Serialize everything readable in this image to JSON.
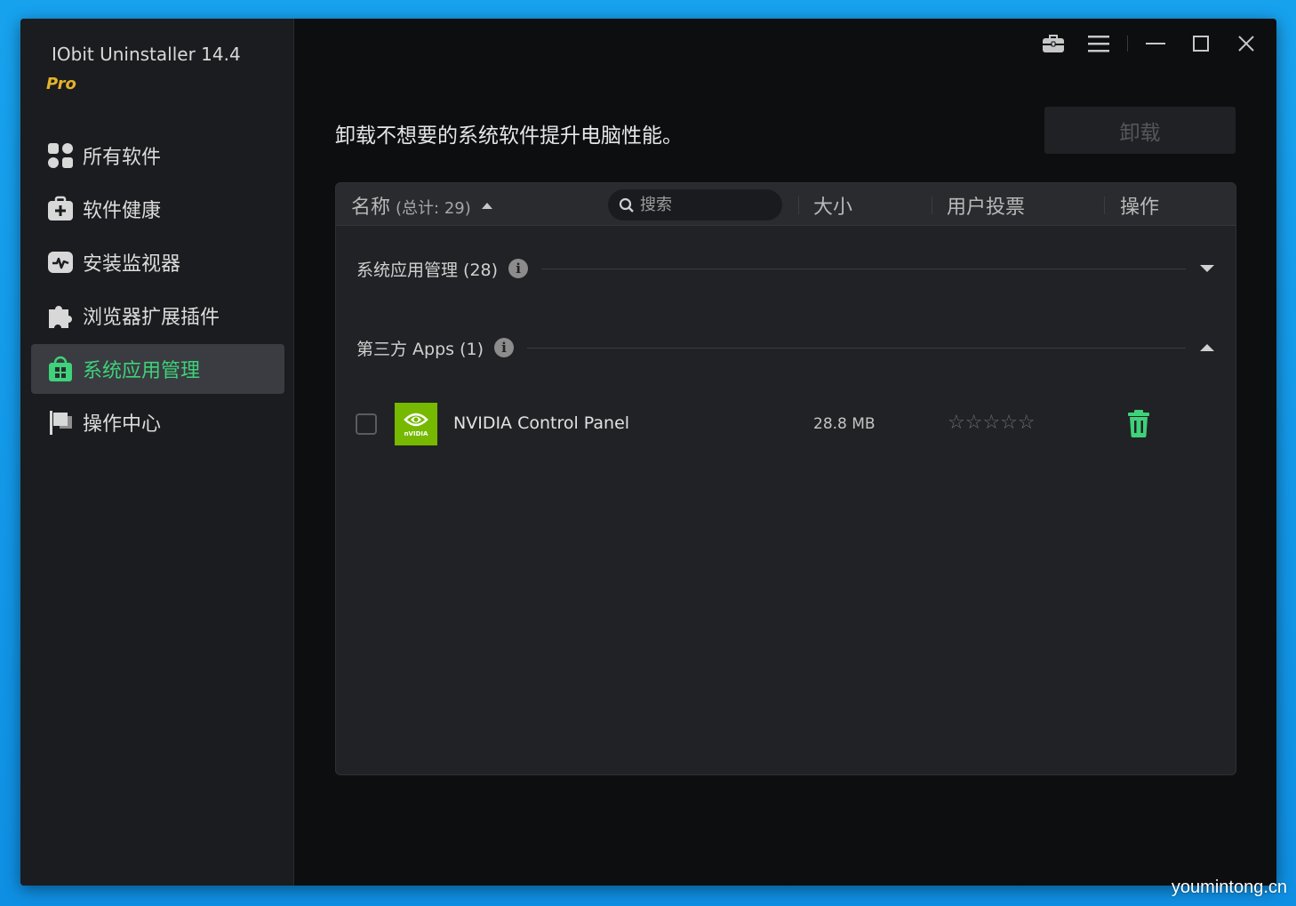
{
  "app": {
    "title": "IObit Uninstaller 14.4",
    "edition": "Pro"
  },
  "sidebar": {
    "items": [
      {
        "label": "所有软件",
        "icon": "grid-apps-icon"
      },
      {
        "label": "软件健康",
        "icon": "first-aid-kit-icon"
      },
      {
        "label": "安装监视器",
        "icon": "monitor-pulse-icon"
      },
      {
        "label": "浏览器扩展插件",
        "icon": "puzzle-icon"
      },
      {
        "label": "系统应用管理",
        "icon": "windows-store-icon",
        "active": true
      },
      {
        "label": "操作中心",
        "icon": "flag-icon"
      }
    ]
  },
  "topbar": {
    "icons": [
      "toolbox-icon",
      "menu-icon",
      "minimize-icon",
      "maximize-icon",
      "close-icon"
    ]
  },
  "main": {
    "heading": "卸载不想要的系统软件提升电脑性能。",
    "uninstall_label": "卸载"
  },
  "table": {
    "headers": {
      "name": "名称",
      "total": "(总计: 29)",
      "size": "大小",
      "rating": "用户投票",
      "action": "操作"
    },
    "search_placeholder": "搜索",
    "groups": [
      {
        "label": "系统应用管理 (28)",
        "expanded": false
      },
      {
        "label": "第三方 Apps (1)",
        "expanded": true
      }
    ],
    "rows": [
      {
        "name": "NVIDIA Control Panel",
        "size": "28.8 MB",
        "stars": "☆☆☆☆☆",
        "logo_text": "nVIDIA"
      }
    ]
  },
  "colors": {
    "accent": "#3ed27a",
    "pro": "#e3b32a",
    "nvidia": "#76b900"
  },
  "watermark": "youmintong.cn"
}
